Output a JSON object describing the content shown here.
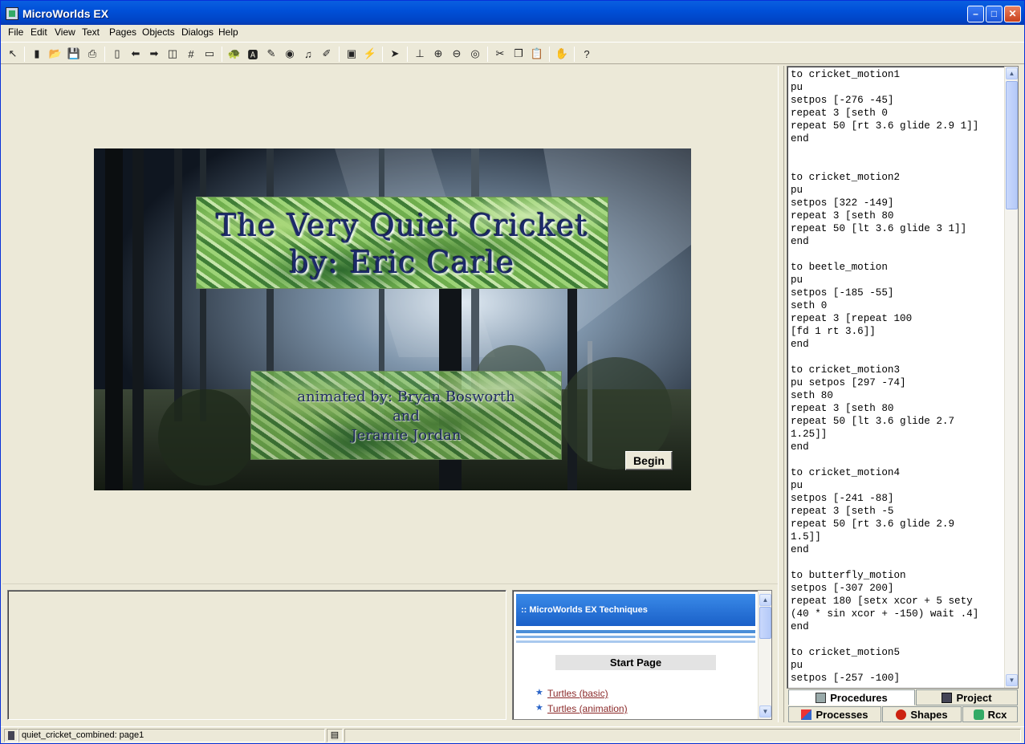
{
  "window": {
    "title": "MicroWorlds EX"
  },
  "menu": [
    "File",
    "Edit",
    "View",
    "Text",
    "Pages",
    "Objects",
    "Dialogs",
    "Help"
  ],
  "toolbar_icons": [
    "pointer-icon",
    "project-icon",
    "open-icon",
    "save-icon",
    "print-icon",
    "new-page-icon",
    "prev-page-icon",
    "next-page-icon",
    "page-layout-icon",
    "grid-icon",
    "box-icon",
    "new-turtle-icon",
    "text-box-icon",
    "paint-icon",
    "video-icon",
    "music-icon",
    "draw-icon",
    "clipboard-icon",
    "lightning-icon",
    "arrow-icon",
    "stamp-icon",
    "zoom-in-icon",
    "zoom-out-icon",
    "eye-icon",
    "cut-icon",
    "copy-icon",
    "paste-icon",
    "stop-icon",
    "help-icon"
  ],
  "scene": {
    "title_line1": "The Very Quiet Cricket",
    "title_line2": "by: Eric Carle",
    "credit_line1": "animated by: Bryan Bosworth",
    "credit_line2": "and",
    "credit_line3": "Jeramie Jordan",
    "begin_label": "Begin"
  },
  "help": {
    "header": ":: MicroWorlds EX Techniques",
    "start_page": "Start Page",
    "links": [
      "Turtles (basic)",
      "Turtles (animation)"
    ]
  },
  "procedures": "to cricket_motion1\npu\nsetpos [-276 -45]\nrepeat 3 [seth 0\nrepeat 50 [rt 3.6 glide 2.9 1]]\nend\n\n\nto cricket_motion2\npu\nsetpos [322 -149]\nrepeat 3 [seth 80\nrepeat 50 [lt 3.6 glide 3 1]]\nend\n\nto beetle_motion\npu\nsetpos [-185 -55]\nseth 0\nrepeat 3 [repeat 100\n[fd 1 rt 3.6]]\nend\n\nto cricket_motion3\npu setpos [297 -74]\nseth 80\nrepeat 3 [seth 80\nrepeat 50 [lt 3.6 glide 2.7\n1.25]]\nend\n\nto cricket_motion4\npu\nsetpos [-241 -88]\nrepeat 3 [seth -5\nrepeat 50 [rt 3.6 glide 2.9\n1.5]]\nend\n\nto butterfly_motion\nsetpos [-307 200]\nrepeat 180 [setx xcor + 5 sety\n(40 * sin xcor + -150) wait .4]\nend\n\nto cricket_motion5\npu\nsetpos [-257 -100]",
  "tabs": {
    "procedures": "Procedures",
    "project": "Project",
    "processes": "Processes",
    "shapes": "Shapes",
    "rcx": "Rcx"
  },
  "status": {
    "page": "quiet_cricket_combined:  page1"
  }
}
